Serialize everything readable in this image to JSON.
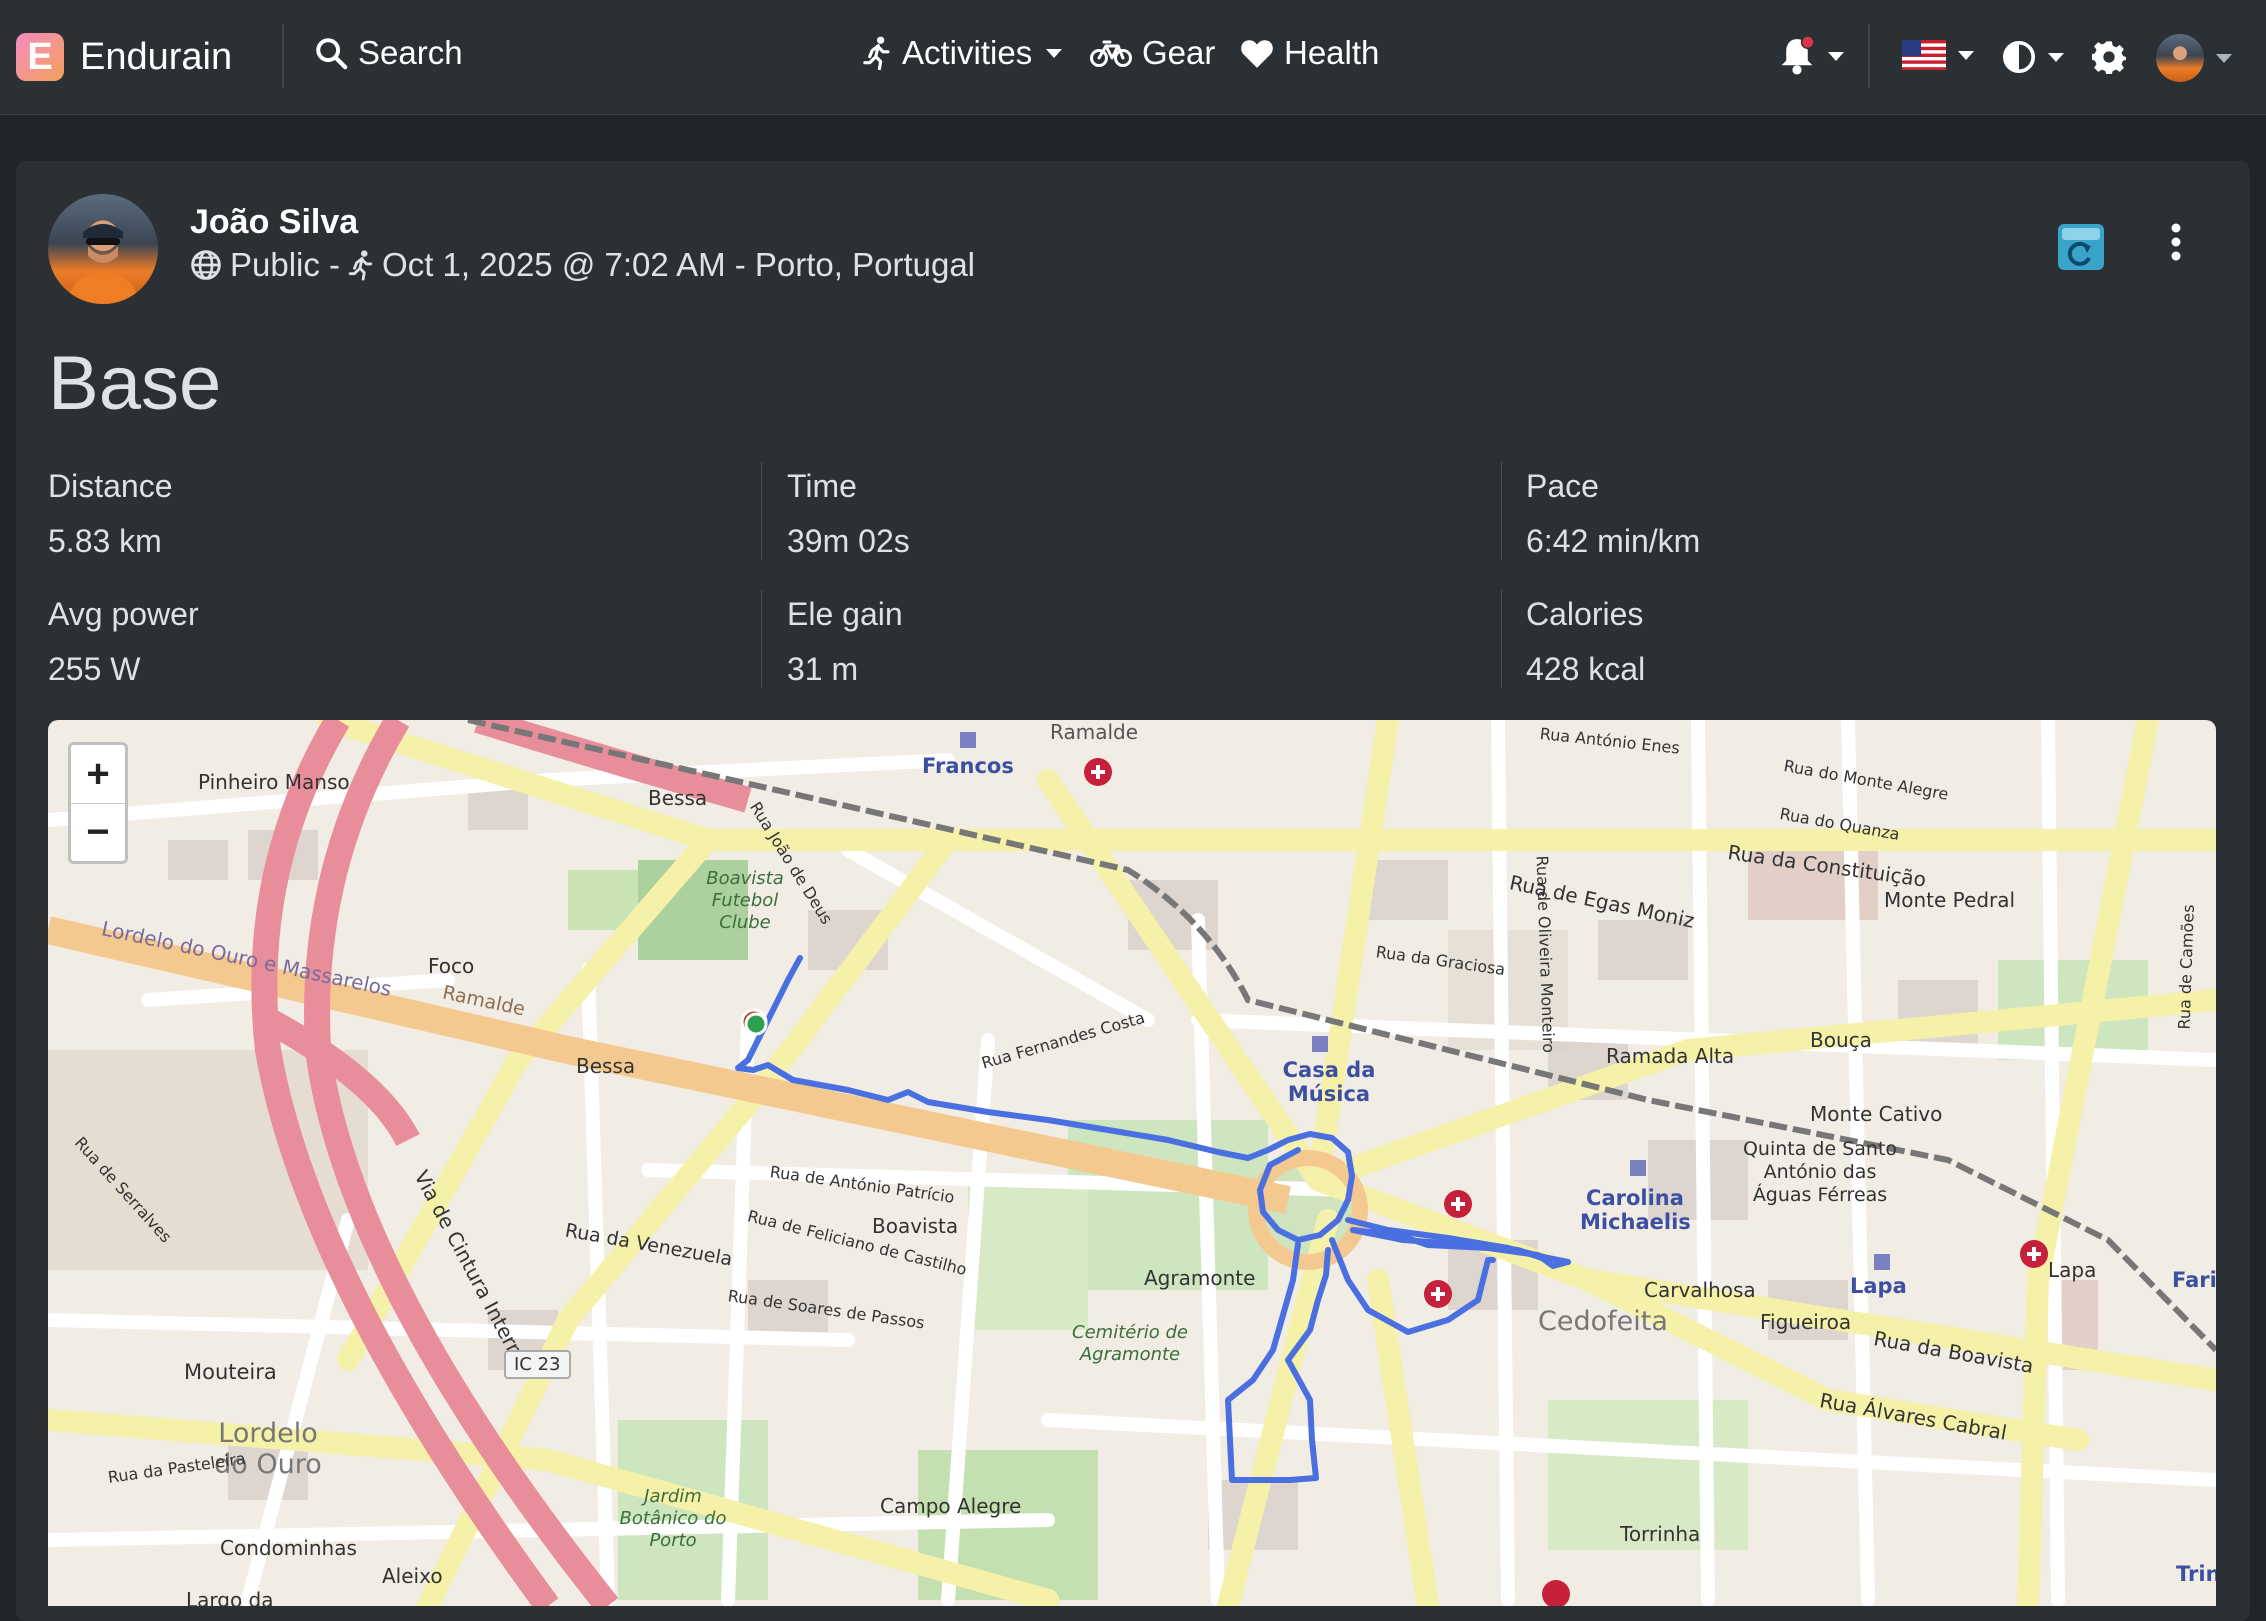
{
  "nav": {
    "brand": "Endurain",
    "search_label": "Search",
    "activities_label": "Activities",
    "gear_label": "Gear",
    "health_label": "Health"
  },
  "activity": {
    "user_name": "João Silva",
    "visibility": "Public -",
    "datetime_location": "Oct 1, 2025 @ 7:02 AM - Porto, Portugal",
    "title": "Base"
  },
  "stats": [
    {
      "label": "Distance",
      "value": "5.83 km"
    },
    {
      "label": "Time",
      "value": "39m 02s"
    },
    {
      "label": "Pace",
      "value": "6:42 min/km"
    },
    {
      "label": "Avg power",
      "value": "255 W"
    },
    {
      "label": "Ele gain",
      "value": "31 m"
    },
    {
      "label": "Calories",
      "value": "428 kcal"
    }
  ],
  "map": {
    "zoom_in": "+",
    "zoom_out": "−",
    "route_color": "#4a6fe0",
    "labels": {
      "pinheiro_manso": "Pinheiro Manso",
      "bessa_top": "Bessa",
      "boavista_fc": "Boavista Futebol Clube",
      "francos": "Francos",
      "ramalde_top": "Ramalde",
      "foco": "Foco",
      "ramalde": "Ramalde",
      "lordelo_massarelos": "Lordelo do Ouro e Massarelos",
      "bessa": "Bessa",
      "via_cintura": "Via de Cintura Interna",
      "rua_venezuela": "Rua da Venezuela",
      "boavista": "Boavista",
      "agramonte": "Agramonte",
      "cemiterio": "Cemitério de Agramonte",
      "casa_musica": "Casa da Música",
      "rua_egas_moniz": "Rua de Egas Moniz",
      "rua_constituicao": "Rua da Constituição",
      "monte_pedral": "Monte Pedral",
      "ramada_alta": "Ramada Alta",
      "bouca": "Bouça",
      "monte_cativo": "Monte Cativo",
      "quinta_santo_antonio": "Quinta de Santo António das Águas Férreas",
      "carolina_michaelis": "Carolina Michaelis",
      "cedofeita": "Cedofeita",
      "carvalhosa": "Carvalhosa",
      "lapa": "Lapa",
      "lapa2": "Lapa",
      "figueiroa": "Figueiroa",
      "rua_boavista": "Rua da Boavista",
      "rua_alvares_cabral": "Rua Álvares Cabral",
      "faria": "Faria G",
      "mouteira": "Mouteira",
      "lordelo_ouro": "Lordelo do Ouro",
      "ic23": "IC 23",
      "campo_alegre": "Campo Alegre",
      "jardim_botanico": "Jardim Botânico do Porto",
      "condominhas": "Condominhas",
      "aleixo": "Aleixo",
      "torrinha": "Torrinha",
      "largo": "Largo da",
      "trin": "Trin",
      "rua_antonio_patricio": "Rua de António Patrício",
      "rua_fernandes_costa": "Rua Fernandes Costa",
      "rua_soares_passos": "Rua de Soares de Passos",
      "rua_serralves": "Rua de Serralves",
      "rua_pasteleira": "Rua da Pasteleira",
      "rua_graciosa": "Rua da Graciosa",
      "rua_oliveira_monteiro": "Rua de Oliveira Monteiro",
      "rua_monte_alegre": "Rua do Monte Alegre",
      "rua_quanza": "Rua do Quanza",
      "rua_antonio_enes": "Rua António Enes",
      "rua_joao_deus": "Rua João de Deus",
      "rua_feliciano_castilho": "Rua de Feliciano de Castilho",
      "rua_camoes": "Rua de Camões"
    }
  }
}
